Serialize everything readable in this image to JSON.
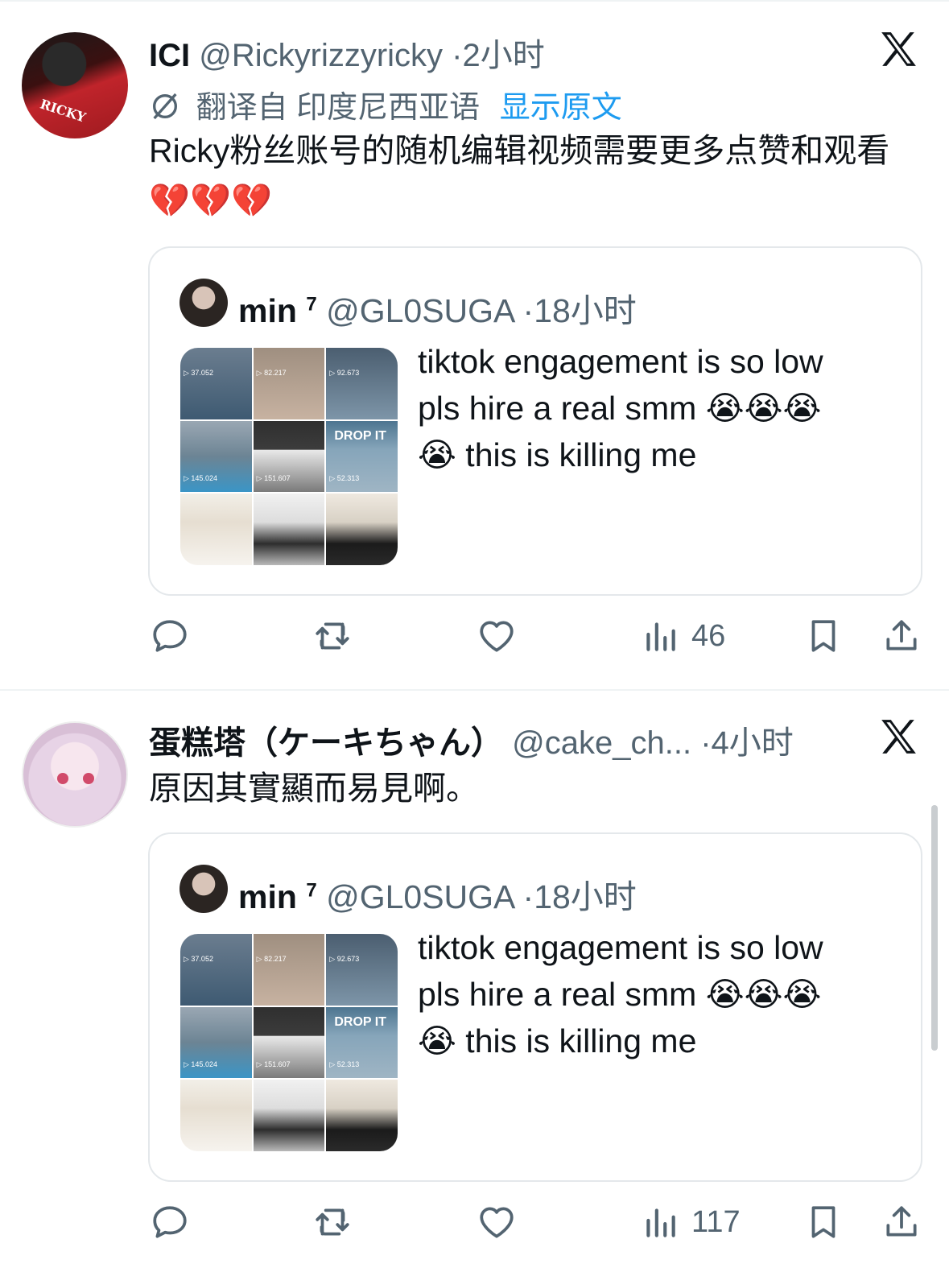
{
  "tweets": [
    {
      "display_name": "ICI",
      "handle": "@Rickyrizzyricky",
      "dot": "·",
      "time": "2小时",
      "translate_note": "翻译自 印度尼西亚语",
      "show_original": "显示原文",
      "text": "Ricky粉丝账号的随机编辑视频需要更多点赞和观看",
      "emoji": "💔💔💔",
      "avatar_text": "RICKY",
      "quote": {
        "display_name": "min",
        "superscript": "7",
        "handle": "@GL0SUGA",
        "dot": "·",
        "time": "18小时",
        "text_line1": "tiktok engagement is so low",
        "text_line2": "pls hire a real smm 😭😭😭",
        "text_line3": "😭 this is killing me",
        "thumbnail_counts": [
          "37.052",
          "82.217",
          "92.673",
          "145.024",
          "151.607",
          "52.313"
        ],
        "thumbnail_label": "DROP IT"
      },
      "views": "46"
    },
    {
      "display_name": "蛋糕塔（ケーキちゃん）",
      "handle": "@cake_ch...",
      "dot": "·",
      "time": "4小时",
      "text": "原因其實顯而易見啊。",
      "quote": {
        "display_name": "min",
        "superscript": "7",
        "handle": "@GL0SUGA",
        "dot": "·",
        "time": "18小时",
        "text_line1": "tiktok engagement is so low",
        "text_line2": "pls hire a real smm 😭😭😭",
        "text_line3": "😭 this is killing me",
        "thumbnail_counts": [
          "37.052",
          "82.217",
          "92.673",
          "145.024",
          "151.607",
          "52.313"
        ],
        "thumbnail_label": "DROP IT"
      },
      "views": "117"
    }
  ],
  "icons": {
    "x_logo": "x-logo-icon",
    "translate": "translate-icon",
    "reply": "reply-icon",
    "retweet": "retweet-icon",
    "like": "heart-icon",
    "views": "views-chart-icon",
    "bookmark": "bookmark-icon",
    "share": "share-icon"
  },
  "colors": {
    "text": "#0f1419",
    "muted": "#536471",
    "link": "#1d9bf0",
    "border": "#e4e8eb"
  }
}
